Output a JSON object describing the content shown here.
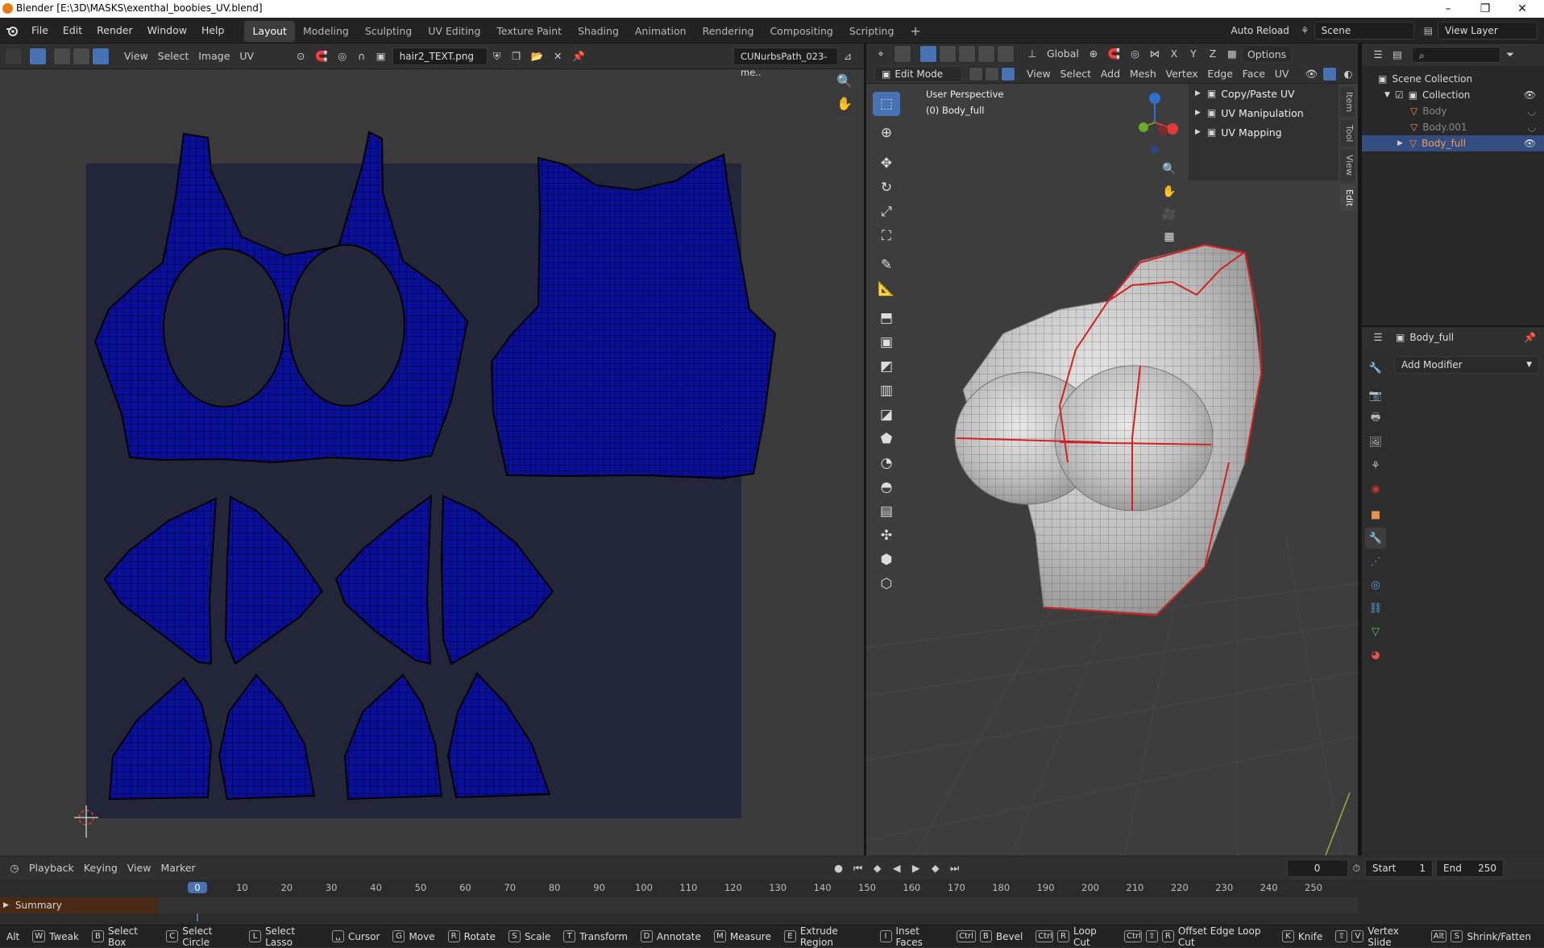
{
  "window": {
    "title": "Blender [E:\\3D\\MASKS\\exenthal_boobies_UV.blend]",
    "controls": [
      "–",
      "❐",
      "✕"
    ]
  },
  "menubar": {
    "menus": [
      "File",
      "Edit",
      "Render",
      "Window",
      "Help"
    ],
    "workspaces": [
      "Layout",
      "Modeling",
      "Sculpting",
      "UV Editing",
      "Texture Paint",
      "Shading",
      "Animation",
      "Rendering",
      "Compositing",
      "Scripting"
    ],
    "active_workspace": "Layout",
    "add_workspace": "+",
    "auto_reload": "Auto Reload",
    "scene": "Scene",
    "view_layer": "View Layer"
  },
  "uv_editor": {
    "menus": [
      "View",
      "Select",
      "Image",
      "UV"
    ],
    "image_name": "hair2_TEXT.png",
    "uv_map": "CUNurbsPath_023-me..",
    "icons": [
      "uv-editor-type-icon",
      "sync-selection-icon",
      "vertex-select-icon",
      "edge-select-icon",
      "face-select-icon",
      "zoom-icon",
      "pan-hand-icon"
    ],
    "mesh_color": "#0a0f9a"
  },
  "viewport": {
    "mode": "Edit Mode",
    "menus": [
      "View",
      "Select",
      "Add",
      "Mesh",
      "Vertex",
      "Edge",
      "Face",
      "UV"
    ],
    "transform_orientation": "Global",
    "options_label": "Options",
    "axes": [
      "X",
      "Y",
      "Z"
    ],
    "perspective_label": "User Perspective",
    "object_label": "(0) Body_full",
    "sidebar_panels": [
      "Copy/Paste UV",
      "UV Manipulation",
      "UV Mapping"
    ],
    "sidebar_tabs": [
      "Item",
      "Tool",
      "View",
      "Edit"
    ],
    "seam_color": "#d42020"
  },
  "outliner": {
    "root": "Scene Collection",
    "collection": "Collection",
    "objects": [
      {
        "name": "Body",
        "selected": false
      },
      {
        "name": "Body.001",
        "selected": false
      },
      {
        "name": "Body_full",
        "selected": true
      }
    ]
  },
  "properties": {
    "object_name": "Body_full",
    "add_modifier": "Add Modifier"
  },
  "timeline": {
    "menus": [
      "Playback",
      "Keying",
      "View",
      "Marker"
    ],
    "current_frame": "0",
    "start_label": "Start",
    "start_value": "1",
    "end_label": "End",
    "end_value": "250",
    "ruler": [
      "0",
      "10",
      "20",
      "30",
      "40",
      "50",
      "60",
      "70",
      "80",
      "90",
      "100",
      "110",
      "120",
      "130",
      "140",
      "150",
      "160",
      "170",
      "180",
      "190",
      "200",
      "210",
      "220",
      "230",
      "240",
      "250"
    ],
    "summary": "Summary"
  },
  "statusbar": {
    "items": [
      {
        "key": "W",
        "label": "Tweak"
      },
      {
        "key": "B",
        "label": "Select Box"
      },
      {
        "key": "C",
        "label": "Select Circle"
      },
      {
        "key": "L",
        "label": "Select Lasso"
      },
      {
        "key": "␣",
        "label": "Cursor"
      },
      {
        "key": "G",
        "label": "Move"
      },
      {
        "key": "R",
        "label": "Rotate"
      },
      {
        "key": "S",
        "label": "Scale"
      },
      {
        "key": "T",
        "label": "Transform"
      },
      {
        "key": "D",
        "label": "Annotate"
      },
      {
        "key": "M",
        "label": "Measure"
      },
      {
        "key": "E",
        "label": "Extrude Region"
      },
      {
        "key": "I",
        "label": "Inset Faces"
      },
      {
        "key": "Ctrl B",
        "label": "Bevel"
      },
      {
        "key": "Ctrl R",
        "label": "Loop Cut"
      },
      {
        "key": "Ctrl ⇧ R",
        "label": "Offset Edge Loop Cut"
      },
      {
        "key": "K",
        "label": "Knife"
      },
      {
        "key": "⇧ V",
        "label": "Vertex Slide"
      },
      {
        "key": "Alt S",
        "label": "Shrink/Fatten"
      }
    ],
    "alt": "Alt"
  }
}
